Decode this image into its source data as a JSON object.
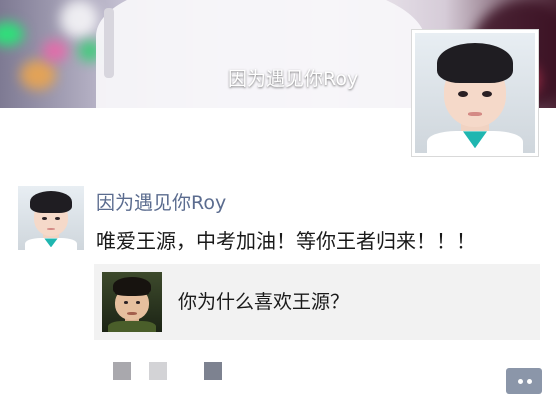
{
  "cover": {
    "name": "因为遇见你Roy"
  },
  "post": {
    "author": "因为遇见你Roy",
    "text": "唯爱王源，中考加油！等你王者归来！！！",
    "shared": {
      "title": "你为什么喜欢王源？"
    }
  },
  "colors": {
    "author_link": "#5b6c8f",
    "share_bg": "#f2f2f2",
    "comment_button": "#8b96a9"
  },
  "icons": {
    "comment": "comment-dots-icon"
  }
}
